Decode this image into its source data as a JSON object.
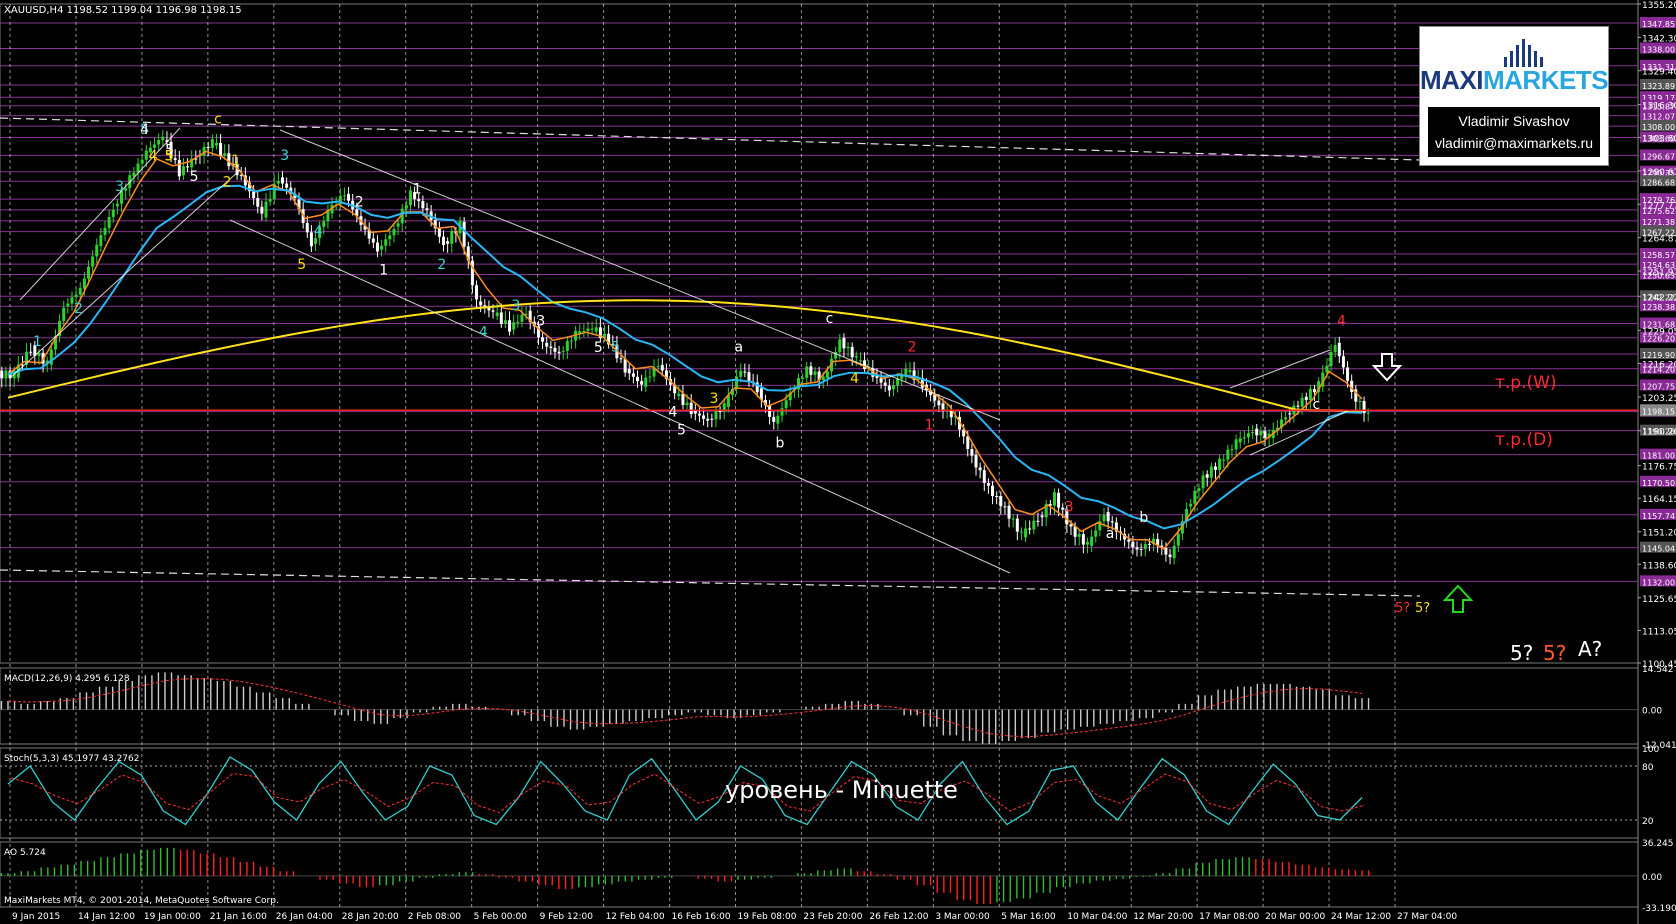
{
  "colors": {
    "background": "#000000",
    "grid": "#ffffff",
    "axis_text": "#ffffff",
    "level_line_purple": "#a03cb0",
    "ema_orange": "#ff8c1a",
    "ema_blue": "#29b6f6",
    "ma_yellow": "#ffe21a",
    "price_line_red": "#ff2020",
    "target_label_red": "#ff2b2b",
    "bull_candle": "#2fd12f",
    "bear_candle": "#ffffff",
    "wave_cyan": "#35d0d0",
    "wave_yellow": "#ffdd00",
    "wave_red": "#ff2a2a",
    "macd_hist": "#cccccc",
    "macd_signal": "#ff3030",
    "stoch_main": "#2fd0d0",
    "stoch_signal": "#ff3030",
    "ao_up": "#2fbf2f",
    "ao_down": "#ff2020"
  },
  "header": {
    "title": "XAUUSD,H4  1198.52 1199.04 1196.98 1198.15"
  },
  "logo": {
    "brand_part1": "MAXI",
    "brand_part2": "MARKETS",
    "author_name": "Vladimir Sivashov",
    "author_email": "vladimir@maximarkets.ru"
  },
  "chart_data": [
    {
      "type": "candlestick",
      "title": "XAUUSD,H4  1198.52 1199.04 1196.98 1198.15",
      "symbol": "XAUUSD",
      "timeframe": "H4",
      "ylim": [
        1100.45,
        1355.2
      ],
      "y_ticks": [
        "1355.20",
        "1342.30",
        "1329.40",
        "1316.30",
        "1303.60",
        "1290.67",
        "1277.77",
        "1264.87",
        "1251.97",
        "1242.22",
        "1229.05",
        "1216.20",
        "1203.25",
        "1190.26",
        "1176.75",
        "1164.15",
        "1151.20",
        "1138.60",
        "1125.65",
        "1113.05",
        "1100.45"
      ],
      "level_labels": [
        "1347.85",
        "1338.00",
        "1331.31",
        "1323.89",
        "1319.17",
        "1315.87",
        "1312.07",
        "1308.00",
        "1303.60",
        "1296.67",
        "1290.35",
        "1286.68",
        "1279.76",
        "1275.62",
        "1271.38",
        "1267.22",
        "1258.57",
        "1254.63",
        "1250.63",
        "1242.22",
        "1238.38",
        "1231.68",
        "1226.20",
        "1219.90",
        "1214.20",
        "1207.75",
        "1197.62",
        "1190.26",
        "1181.00",
        "1170.50",
        "1157.74",
        "1145.04",
        "1132.00"
      ],
      "x_ticks": [
        "9 Jan 2015",
        "14 Jan 12:00",
        "19 Jan 00:00",
        "21 Jan 16:00",
        "26 Jan 04:00",
        "28 Jan 20:00",
        "2 Feb 08:00",
        "5 Feb 00:00",
        "9 Feb 12:00",
        "12 Feb 04:00",
        "16 Feb 16:00",
        "19 Feb 08:00",
        "23 Feb 20:00",
        "26 Feb 12:00",
        "3 Mar 00:00",
        "5 Mar 16:00",
        "10 Mar 04:00",
        "12 Mar 20:00",
        "17 Mar 08:00",
        "20 Mar 00:00",
        "24 Mar 12:00",
        "27 Mar 04:00"
      ],
      "price_path": [
        1212,
        1222,
        1216,
        1238,
        1245,
        1262,
        1276,
        1288,
        1298,
        1304,
        1290,
        1296,
        1302,
        1294,
        1286,
        1274,
        1288,
        1280,
        1262,
        1275,
        1282,
        1270,
        1260,
        1268,
        1282,
        1275,
        1262,
        1270,
        1240,
        1236,
        1230,
        1236,
        1224,
        1220,
        1228,
        1230,
        1225,
        1214,
        1208,
        1216,
        1205,
        1198,
        1194,
        1200,
        1214,
        1206,
        1193,
        1205,
        1214,
        1210,
        1225,
        1218,
        1212,
        1206,
        1214,
        1208,
        1200,
        1195,
        1180,
        1168,
        1160,
        1150,
        1156,
        1165,
        1152,
        1146,
        1158,
        1150,
        1144,
        1148,
        1141,
        1160,
        1172,
        1178,
        1186,
        1190,
        1188,
        1196,
        1202,
        1208,
        1224,
        1205,
        1196
      ],
      "current_price": 1198.15,
      "annotations": [
        "т.р.(W)",
        "т.р.(D)",
        "5?",
        "5?",
        "A?"
      ],
      "wave_labels": [
        "1",
        "2",
        "3",
        "4",
        "5",
        "3",
        "5",
        "5",
        "c",
        "5",
        "4",
        "5",
        "1",
        "2",
        "3",
        "4",
        "2",
        "1",
        "1",
        "2",
        "3",
        "4",
        "3",
        "5",
        "5",
        "4",
        "3",
        "5",
        "a",
        "b",
        "c",
        "4",
        "2",
        "1",
        "3",
        "a",
        "b",
        "c",
        "4"
      ]
    },
    {
      "type": "bar",
      "title": "MACD(12,26,9) 4.295 6.128",
      "ylim": [
        -12.041,
        14.542
      ],
      "y_ticks": [
        "14.542",
        "0.00",
        "-12.041"
      ],
      "macd_values": [
        3,
        2,
        3,
        4,
        6,
        8,
        10,
        12,
        13,
        12,
        11,
        10,
        8,
        6,
        4,
        2,
        0,
        -2,
        -4,
        -5,
        -3,
        -1,
        1,
        2,
        1,
        0,
        -2,
        -4,
        -6,
        -7,
        -6,
        -5,
        -4,
        -3,
        -2,
        -1,
        -2,
        -3,
        -2,
        -1,
        0,
        1,
        2,
        3,
        2,
        0,
        -2,
        -6,
        -9,
        -11,
        -12,
        -11,
        -10,
        -8,
        -7,
        -6,
        -5,
        -4,
        -3,
        -1,
        2,
        5,
        7,
        8,
        9,
        9,
        8,
        7,
        5,
        4
      ]
    },
    {
      "type": "line",
      "title": "Stoch(5,3,3) 45.1977 43.2762",
      "ylim": [
        0,
        100
      ],
      "y_ticks": [
        "100",
        "80",
        "20"
      ],
      "stoch_values": [
        60,
        80,
        40,
        20,
        55,
        85,
        70,
        30,
        15,
        50,
        90,
        75,
        40,
        20,
        60,
        85,
        50,
        20,
        35,
        80,
        70,
        25,
        15,
        45,
        85,
        60,
        30,
        20,
        70,
        88,
        55,
        20,
        40,
        80,
        65,
        25,
        15,
        50,
        85,
        70,
        35,
        20,
        60,
        85,
        45,
        15,
        30,
        75,
        80,
        40,
        20,
        55,
        88,
        70,
        30,
        15,
        50,
        82,
        60,
        25,
        20,
        45
      ]
    },
    {
      "type": "bar",
      "title": "AO 5.724",
      "ylim": [
        -33.19,
        36.245
      ],
      "y_ticks": [
        "36.245",
        "0.00",
        "-33.190"
      ],
      "ao_values": [
        3,
        5,
        9,
        12,
        16,
        20,
        24,
        28,
        30,
        28,
        24,
        20,
        15,
        10,
        5,
        0,
        -4,
        -8,
        -12,
        -10,
        -6,
        -2,
        2,
        4,
        2,
        -2,
        -6,
        -10,
        -14,
        -12,
        -9,
        -6,
        -4,
        -2,
        0,
        -3,
        -6,
        -4,
        -2,
        0,
        3,
        6,
        8,
        5,
        2,
        -4,
        -10,
        -18,
        -26,
        -30,
        -28,
        -24,
        -18,
        -12,
        -8,
        -5,
        -3,
        -1,
        3,
        8,
        14,
        18,
        20,
        18,
        15,
        12,
        9,
        7,
        6
      ]
    }
  ],
  "overlay_label": "уровень - Minuette",
  "footer": "MaxiMarkets MT4, © 2001-2014, MetaQuotes Software Corp."
}
